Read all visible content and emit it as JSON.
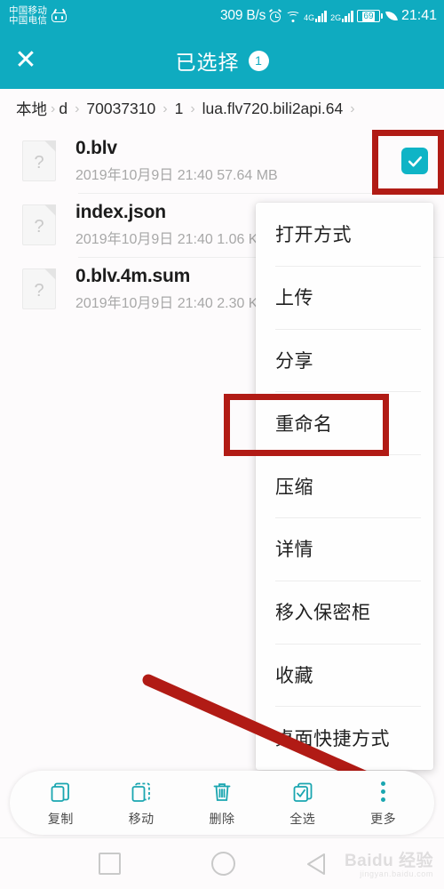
{
  "colors": {
    "accent_teal": "#0fabc0",
    "checkbox_teal": "#0fb4c6",
    "highlight_red": "#b11b15",
    "page_bg": "#fdfbfc",
    "toolbar_icon": "#1aa6b0"
  },
  "status_bar": {
    "carrier_line1": "中国移动",
    "carrier_line2": "中国电信",
    "app_icon_name": "bilibili-tv-icon",
    "network_speed": "309 B/s",
    "alarm_icon_name": "alarm-clock-icon",
    "wifi_icon_name": "wifi-icon",
    "signal_1_label": "4G",
    "signal_2_label": "2G",
    "battery_level": "69",
    "power_saving_icon_name": "leaf-icon",
    "time": "21:41"
  },
  "title_bar": {
    "close_label": "✕",
    "title": "已选择",
    "selected_count": "1"
  },
  "breadcrumb": {
    "separator": "›",
    "items": [
      {
        "label": "本地"
      },
      {
        "label": "d"
      },
      {
        "label": "70037310"
      },
      {
        "label": "1"
      },
      {
        "label": "lua.flv720.bili2api.64"
      }
    ]
  },
  "file_list": {
    "icon_glyph": "?",
    "rows": [
      {
        "name": "0.blv",
        "meta": "2019年10月9日 21:40 57.64 MB",
        "checked": true
      },
      {
        "name": "index.json",
        "meta": "2019年10月9日 21:40 1.06 KB",
        "checked": false
      },
      {
        "name": "0.blv.4m.sum",
        "meta": "2019年10月9日 21:40 2.30 KB",
        "checked": false
      }
    ]
  },
  "popup_menu": {
    "items": [
      {
        "label": "打开方式"
      },
      {
        "label": "上传"
      },
      {
        "label": "分享"
      },
      {
        "label": "重命名",
        "highlighted": true
      },
      {
        "label": "压缩"
      },
      {
        "label": "详情"
      },
      {
        "label": "移入保密柜"
      },
      {
        "label": "收藏"
      },
      {
        "label": "桌面快捷方式"
      }
    ]
  },
  "bottom_toolbar": {
    "items": [
      {
        "label": "复制",
        "icon": "copy-icon"
      },
      {
        "label": "移动",
        "icon": "move-icon"
      },
      {
        "label": "删除",
        "icon": "trash-icon"
      },
      {
        "label": "全选",
        "icon": "select-all-icon"
      },
      {
        "label": "更多",
        "icon": "more-vertical-icon"
      }
    ]
  },
  "nav_bar": {
    "recents_icon": "square-icon",
    "home_icon": "circle-icon",
    "back_icon": "triangle-back-icon"
  },
  "watermark": {
    "main": "Baidu 经验",
    "sub": "jingyan.baidu.com"
  }
}
